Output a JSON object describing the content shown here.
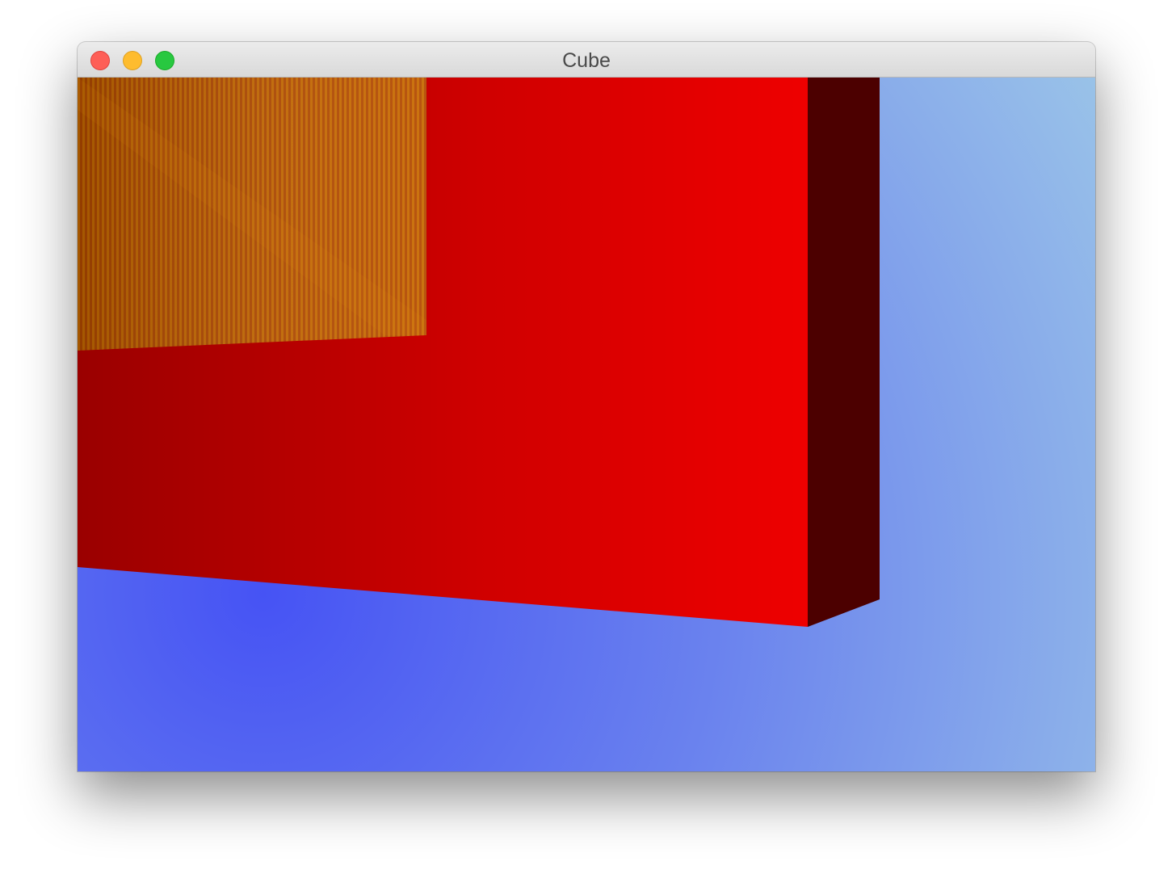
{
  "window": {
    "title": "Cube",
    "controls": {
      "close": "close-button",
      "minimize": "minimize-button",
      "zoom": "zoom-button"
    }
  },
  "scene": {
    "description_colors": {
      "background_light": "#9ac2e8",
      "background_deep": "#4653f4",
      "front_face_dark": "#9a0000",
      "front_face_bright": "#ee0000",
      "side_face": "#4c0000",
      "overlay_orange": "#d87a00"
    }
  }
}
